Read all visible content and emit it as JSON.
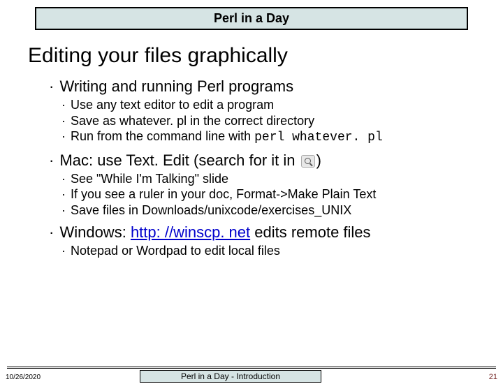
{
  "header": "Perl in a Day",
  "title": "Editing your files graphically",
  "b1": {
    "text": "Writing and running Perl programs",
    "sub": [
      "Use any text editor to edit a program",
      "Save as whatever. pl in the correct directory"
    ],
    "sub3_a": "Run from the command line with ",
    "sub3_b": "perl whatever. pl"
  },
  "b2": {
    "pre": "Mac: use Text. Edit (search for it in ",
    "post": ")",
    "sub": [
      "See \"While I'm Talking\" slide",
      "If you see a ruler in your doc, Format->Make Plain Text",
      "Save files in Downloads/unixcode/exercises_UNIX"
    ]
  },
  "b3": {
    "pre": "Windows: ",
    "link": "http: //winscp. net",
    "post": " edits remote files",
    "sub": [
      "Notepad or Wordpad to edit local files"
    ]
  },
  "footer": {
    "date": "10/26/2020",
    "center": "Perl in a Day - Introduction",
    "page": "21"
  }
}
